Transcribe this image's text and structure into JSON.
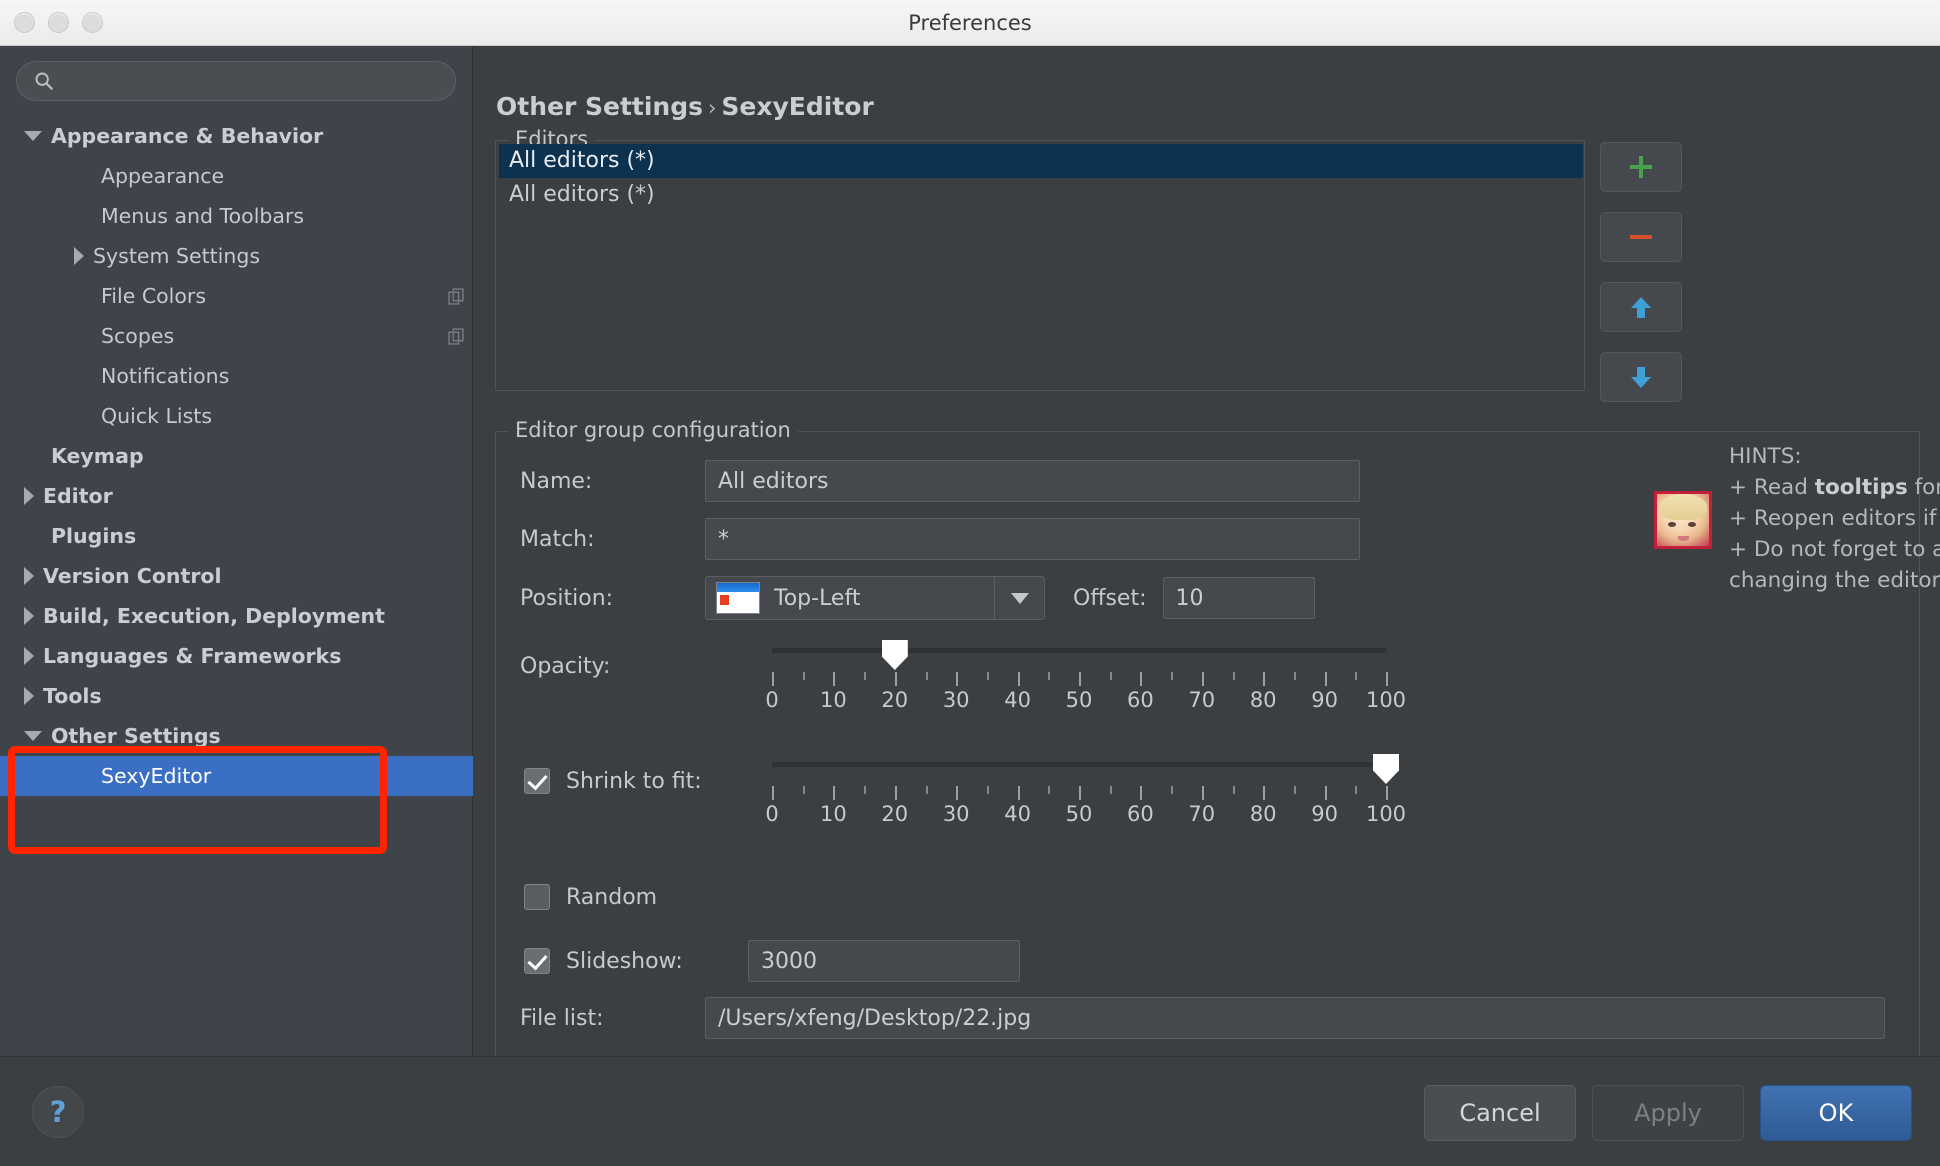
{
  "window": {
    "title": "Preferences",
    "traffic_lights": [
      "close-button",
      "minimize-button",
      "zoom-button"
    ]
  },
  "search": {
    "placeholder": "",
    "value": "",
    "icon": "search-icon"
  },
  "sidebar": {
    "items": [
      {
        "label": "Appearance & Behavior",
        "indent": 0,
        "arrow": "down",
        "bold": true,
        "selected": false,
        "badge": false
      },
      {
        "label": "Appearance",
        "indent": 1,
        "arrow": "none",
        "bold": false,
        "selected": false,
        "badge": false
      },
      {
        "label": "Menus and Toolbars",
        "indent": 1,
        "arrow": "none",
        "bold": false,
        "selected": false,
        "badge": false
      },
      {
        "label": "System Settings",
        "indent": 1,
        "arrow": "right",
        "bold": false,
        "selected": false,
        "badge": false
      },
      {
        "label": "File Colors",
        "indent": 1,
        "arrow": "none",
        "bold": false,
        "selected": false,
        "badge": true
      },
      {
        "label": "Scopes",
        "indent": 1,
        "arrow": "none",
        "bold": false,
        "selected": false,
        "badge": true
      },
      {
        "label": "Notifications",
        "indent": 1,
        "arrow": "none",
        "bold": false,
        "selected": false,
        "badge": false
      },
      {
        "label": "Quick Lists",
        "indent": 1,
        "arrow": "none",
        "bold": false,
        "selected": false,
        "badge": false
      },
      {
        "label": "Keymap",
        "indent": 0,
        "arrow": "none",
        "bold": true,
        "selected": false,
        "badge": false
      },
      {
        "label": "Editor",
        "indent": 0,
        "arrow": "right",
        "bold": true,
        "selected": false,
        "badge": false
      },
      {
        "label": "Plugins",
        "indent": 0,
        "arrow": "none",
        "bold": true,
        "selected": false,
        "badge": false
      },
      {
        "label": "Version Control",
        "indent": 0,
        "arrow": "right",
        "bold": true,
        "selected": false,
        "badge": false
      },
      {
        "label": "Build, Execution, Deployment",
        "indent": 0,
        "arrow": "right",
        "bold": true,
        "selected": false,
        "badge": false
      },
      {
        "label": "Languages & Frameworks",
        "indent": 0,
        "arrow": "right",
        "bold": true,
        "selected": false,
        "badge": false
      },
      {
        "label": "Tools",
        "indent": 0,
        "arrow": "right",
        "bold": true,
        "selected": false,
        "badge": false
      },
      {
        "label": "Other Settings",
        "indent": 0,
        "arrow": "down",
        "bold": true,
        "selected": false,
        "badge": false
      },
      {
        "label": "SexyEditor",
        "indent": 1,
        "arrow": "none",
        "bold": false,
        "selected": true,
        "badge": false
      }
    ],
    "annotation_color": "#ff2400"
  },
  "breadcrumb": {
    "parent": "Other Settings",
    "separator": "›",
    "current": "SexyEditor"
  },
  "editors_group": {
    "title": "Editors",
    "rows": [
      {
        "label": "All editors (*)",
        "selected": true
      },
      {
        "label": "All editors (*)",
        "selected": false
      }
    ]
  },
  "side_toolbar": {
    "buttons": [
      {
        "name": "add-button",
        "icon": "plus-icon",
        "color": "#49a24c"
      },
      {
        "name": "remove-button",
        "icon": "minus-icon",
        "color": "#d8502a"
      },
      {
        "name": "move-up-button",
        "icon": "arrow-up-icon",
        "color": "#3f9fd6"
      },
      {
        "name": "move-down-button",
        "icon": "arrow-down-icon",
        "color": "#3f9fd6"
      }
    ]
  },
  "config_group": {
    "title": "Editor group configuration",
    "name": {
      "label": "Name:",
      "value": "All editors"
    },
    "match": {
      "label": "Match:",
      "value": "*"
    },
    "position": {
      "label": "Position:",
      "value": "Top-Left",
      "icon": "window-position-icon",
      "caret": "chevron-down-icon"
    },
    "offset": {
      "label": "Offset:",
      "value": "10"
    },
    "opacity": {
      "label": "Opacity:",
      "value": 20,
      "min": 0,
      "max": 100,
      "ticks": [
        0,
        10,
        20,
        30,
        40,
        50,
        60,
        70,
        80,
        90,
        100
      ]
    },
    "shrink": {
      "label": "Shrink to fit:",
      "checked": true,
      "value": 100,
      "min": 0,
      "max": 100,
      "ticks": [
        0,
        10,
        20,
        30,
        40,
        50,
        60,
        70,
        80,
        90,
        100
      ]
    },
    "random": {
      "label": "Random",
      "checked": false
    },
    "slideshow": {
      "label": "Slideshow:",
      "checked": true,
      "value": "3000"
    },
    "file_list": {
      "label": "File list:",
      "value": "/Users/xfeng/Desktop/22.jpg"
    }
  },
  "hints": {
    "heading": "HINTS:",
    "avatar": "avatar-thumbnail",
    "line1_pre": "+ Read ",
    "line1_bold": "tooltips",
    "line1_post": " for more help.",
    "line2": "+ Reopen editors if changes ar",
    "line3": "+ Do not forget to apply chang",
    "line4": "changing the editor group."
  },
  "footer": {
    "help": "?",
    "cancel": "Cancel",
    "apply": "Apply",
    "ok": "OK"
  }
}
